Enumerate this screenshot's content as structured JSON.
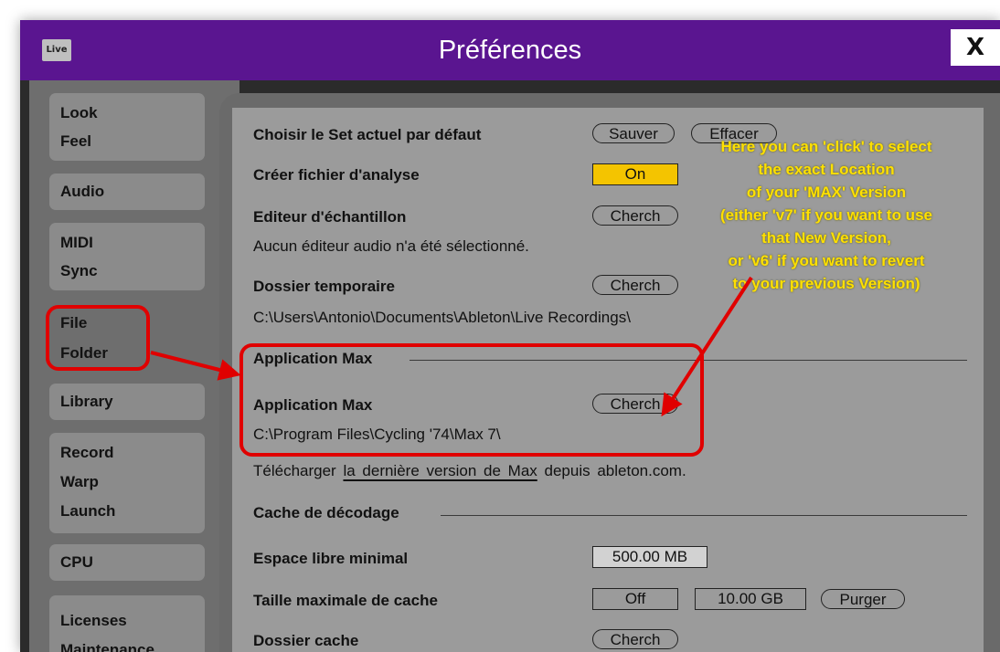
{
  "window": {
    "title": "Préférences",
    "app_icon_text": "Live",
    "close_label": "X"
  },
  "sidebar": {
    "groups": [
      {
        "items": [
          "Look",
          "Feel"
        ]
      },
      {
        "items": [
          "Audio"
        ]
      },
      {
        "items": [
          "MIDI",
          "Sync"
        ]
      },
      {
        "items": [
          "File",
          "Folder"
        ],
        "selected": true
      },
      {
        "items": [
          "Library"
        ]
      },
      {
        "items": [
          "Record",
          "Warp",
          "Launch"
        ]
      },
      {
        "items": [
          "CPU"
        ]
      },
      {
        "items": [
          "Licenses",
          "Maintenance"
        ]
      }
    ]
  },
  "content": {
    "default_set": {
      "label": "Choisir le Set actuel par défaut",
      "save_label": "Sauver",
      "clear_label": "Effacer"
    },
    "analysis_file": {
      "label": "Créer fichier d'analyse",
      "value": "On"
    },
    "sample_editor": {
      "label": "Editeur d'échantillon",
      "button": "Cherch",
      "status": "Aucun éditeur audio n'a été sélectionné."
    },
    "temp_folder": {
      "label": "Dossier temporaire",
      "button": "Cherch",
      "path": "C:\\Users\\Antonio\\Documents\\Ableton\\Live Recordings\\"
    },
    "max_section": {
      "title": "Application Max",
      "label": "Application Max",
      "button": "Cherch",
      "path": "C:\\Program Files\\Cycling '74\\Max 7\\",
      "download_prefix": "Télécharger",
      "download_link": "la dernière version de Max",
      "download_suffix": "depuis ableton.com."
    },
    "decode_cache": {
      "title": "Cache de décodage",
      "min_free_label": "Espace libre minimal",
      "min_free_value": "500.00 MB",
      "max_size_label": "Taille maximale de cache",
      "max_size_off": "Off",
      "max_size_value": "10.00 GB",
      "purge_label": "Purger",
      "cache_folder_label": "Dossier cache",
      "cache_folder_button": "Cherch"
    }
  },
  "annotation": {
    "lines": [
      "Here you can 'click' to select",
      "the exact Location",
      "of your 'MAX' Version",
      "(either 'v7' if you want to use",
      "that New Version,",
      "or 'v6' if you want to revert",
      "to your previous Version)"
    ]
  },
  "colors": {
    "titlebar": "#5a1590",
    "on_toggle": "#f4c400",
    "annotation_text": "#ffe000",
    "highlight": "#e00000"
  }
}
